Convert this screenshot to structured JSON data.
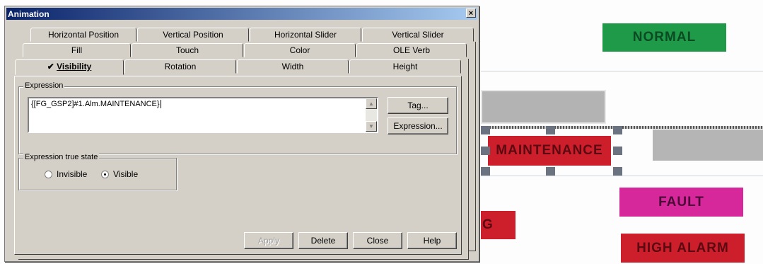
{
  "dialog": {
    "title": "Animation",
    "close_glyph": "×",
    "tabs_row1": [
      "Horizontal Position",
      "Vertical Position",
      "Horizontal Slider",
      "Vertical Slider"
    ],
    "tabs_row2": [
      "Fill",
      "Touch",
      "Color",
      "OLE Verb"
    ],
    "tabs_row3": [
      "Visibility",
      "Rotation",
      "Width",
      "Height"
    ],
    "active_tab_check": "✔",
    "expression": {
      "label": "Expression",
      "value": "{[FG_GSP2]#1.Alm.MAINTENANCE}",
      "tag_button": "Tag...",
      "expression_button": "Expression..."
    },
    "true_state": {
      "label": "Expression true state",
      "options": [
        "Invisible",
        "Visible"
      ],
      "selected": "Visible"
    },
    "buttons": {
      "apply": "Apply",
      "delete": "Delete",
      "close": "Close",
      "help": "Help"
    }
  },
  "hmi": {
    "normal": "NORMAL",
    "maintenance": "MAINTENANCE",
    "fault": "FAULT",
    "high_alarm": "HIGH ALARM",
    "partial": "G",
    "colors": {
      "normal": "#1f9a48",
      "alarm": "#cc1f2b",
      "fault": "#d6279b"
    }
  }
}
